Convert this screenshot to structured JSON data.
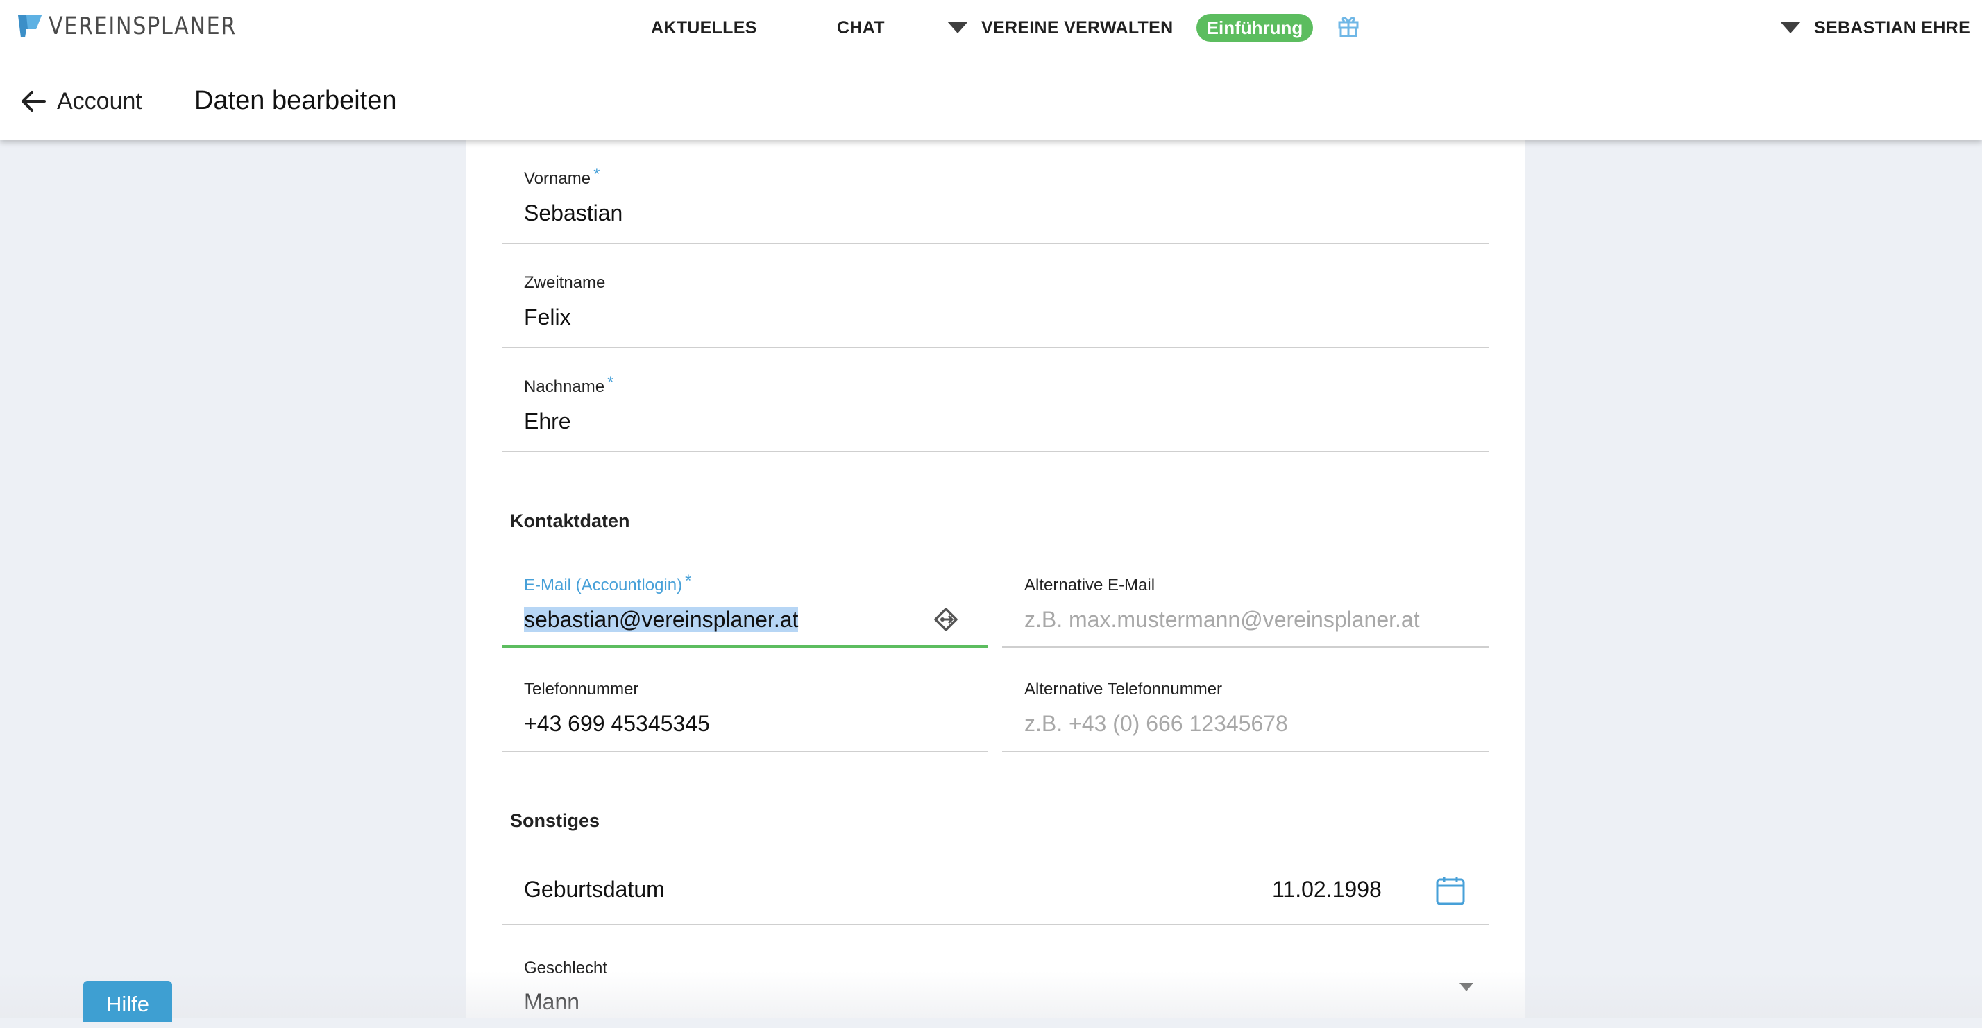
{
  "header": {
    "logo_text": "VEREINSPLANER",
    "nav": {
      "aktuelles": "AKTUELLES",
      "chat": "CHAT",
      "vereine": "VEREINE VERWALTEN",
      "badge": "Einführung",
      "user": "SEBASTIAN EHRE"
    },
    "back_label": "Account",
    "page_title": "Daten bearbeiten"
  },
  "form": {
    "vorname": {
      "label": "Vorname",
      "required": "*",
      "value": "Sebastian"
    },
    "zweitname": {
      "label": "Zweitname",
      "value": "Felix"
    },
    "nachname": {
      "label": "Nachname",
      "required": "*",
      "value": "Ehre"
    },
    "kontakt_heading": "Kontaktdaten",
    "email": {
      "label": "E-Mail (Accountlogin)",
      "required": "*",
      "value": "sebastian@vereinsplaner.at"
    },
    "alt_email": {
      "label": "Alternative E-Mail",
      "placeholder": "z.B. max.mustermann@vereinsplaner.at"
    },
    "telefon": {
      "label": "Telefonnummer",
      "value": "+43 699 45345345"
    },
    "alt_telefon": {
      "label": "Alternative Telefonnummer",
      "placeholder": "z.B. +43 (0) 666 12345678"
    },
    "sonstiges_heading": "Sonstiges",
    "geburtsdatum": {
      "label": "Geburtsdatum",
      "value": "11.02.1998"
    },
    "geschlecht": {
      "label": "Geschlecht",
      "value": "Mann"
    }
  },
  "help_label": "Hilfe",
  "colors": {
    "accent_blue": "#47a0d8",
    "active_green": "#5cbd5f",
    "background": "#edf0f5",
    "help_button": "#3e9fd2"
  }
}
